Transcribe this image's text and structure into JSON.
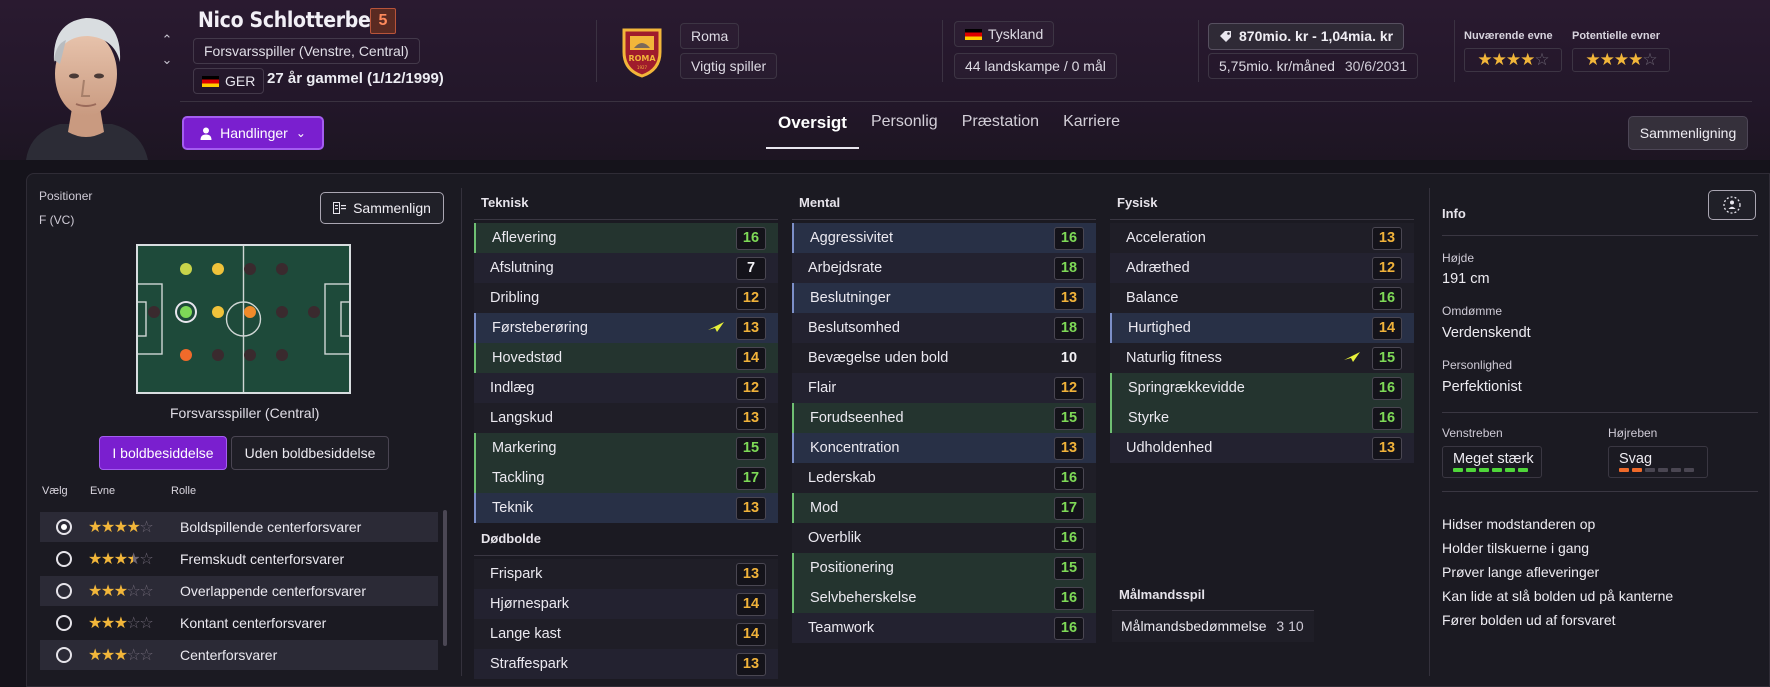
{
  "player": {
    "name": "Nico Schlotterbeck",
    "number": "5",
    "position": "Forsvarsspiller (Venstre, Central)",
    "nationality_code": "GER",
    "age_text": "27 år gammel (1/12/1999)"
  },
  "club": {
    "name": "Roma",
    "role": "Vigtig spiller"
  },
  "country": {
    "name": "Tyskland",
    "caps": "44 landskampe / 0 mål"
  },
  "contract": {
    "value": "870mio. kr - 1,04mia. kr",
    "wage": "5,75mio. kr/måned",
    "expiry": "30/6/2031"
  },
  "ability": {
    "current_label": "Nuværende evne",
    "current_stars": 4,
    "potential_label": "Potentielle evner",
    "potential_stars": 4
  },
  "actions_label": "Handlinger",
  "tabs": [
    {
      "label": "Oversigt",
      "active": true
    },
    {
      "label": "Personlig",
      "active": false
    },
    {
      "label": "Præstation",
      "active": false
    },
    {
      "label": "Karriere",
      "active": false
    }
  ],
  "compare_top_label": "Sammenligning",
  "positions_panel": {
    "title": "Positioner",
    "position_code": "F (VC)",
    "compare_label": "Sammenlign",
    "caption": "Forsvarsspiller (Central)",
    "toggle_on": "I boldbesiddelse",
    "toggle_off": "Uden boldbesiddelse",
    "head_select": "Vælg",
    "head_ability": "Evne",
    "head_role": "Rolle",
    "roles": [
      {
        "name": "Boldspillende centerforsvarer",
        "stars": 4,
        "selected": true
      },
      {
        "name": "Fremskudt centerforsvarer",
        "stars": 3.5,
        "selected": false
      },
      {
        "name": "Overlappende centerforsvarer",
        "stars": 3,
        "selected": false
      },
      {
        "name": "Kontant centerforsvarer",
        "stars": 3,
        "selected": false
      },
      {
        "name": "Centerforsvarer",
        "stars": 3,
        "selected": false
      }
    ]
  },
  "technical": {
    "title": "Teknisk",
    "attrs": [
      {
        "name": "Aflevering",
        "value": "16",
        "hl": "green"
      },
      {
        "name": "Afslutning",
        "value": "7",
        "hl": ""
      },
      {
        "name": "Dribling",
        "value": "12",
        "hl": ""
      },
      {
        "name": "Førsteberøring",
        "value": "13",
        "hl": "blue",
        "trend": true
      },
      {
        "name": "Hovedstød",
        "value": "14",
        "hl": "green"
      },
      {
        "name": "Indlæg",
        "value": "12",
        "hl": ""
      },
      {
        "name": "Langskud",
        "value": "13",
        "hl": ""
      },
      {
        "name": "Markering",
        "value": "15",
        "hl": "green"
      },
      {
        "name": "Tackling",
        "value": "17",
        "hl": "green"
      },
      {
        "name": "Teknik",
        "value": "13",
        "hl": "blue"
      }
    ]
  },
  "set_pieces": {
    "title": "Dødbolde",
    "attrs": [
      {
        "name": "Frispark",
        "value": "13"
      },
      {
        "name": "Hjørnespark",
        "value": "14"
      },
      {
        "name": "Lange kast",
        "value": "14"
      },
      {
        "name": "Straffespark",
        "value": "13"
      }
    ]
  },
  "mental": {
    "title": "Mental",
    "attrs": [
      {
        "name": "Aggressivitet",
        "value": "16",
        "hl": "blue"
      },
      {
        "name": "Arbejdsrate",
        "value": "18",
        "hl": ""
      },
      {
        "name": "Beslutninger",
        "value": "13",
        "hl": "blue"
      },
      {
        "name": "Beslutsomhed",
        "value": "18",
        "hl": ""
      },
      {
        "name": "Bevægelse uden bold",
        "value": "10",
        "hl": ""
      },
      {
        "name": "Flair",
        "value": "12",
        "hl": ""
      },
      {
        "name": "Forudseenhed",
        "value": "15",
        "hl": "green"
      },
      {
        "name": "Koncentration",
        "value": "13",
        "hl": "blue"
      },
      {
        "name": "Lederskab",
        "value": "16",
        "hl": ""
      },
      {
        "name": "Mod",
        "value": "17",
        "hl": "green"
      },
      {
        "name": "Overblik",
        "value": "16",
        "hl": ""
      },
      {
        "name": "Positionering",
        "value": "15",
        "hl": "green"
      },
      {
        "name": "Selvbeherskelse",
        "value": "16",
        "hl": "green"
      },
      {
        "name": "Teamwork",
        "value": "16",
        "hl": ""
      }
    ]
  },
  "physical": {
    "title": "Fysisk",
    "attrs": [
      {
        "name": "Acceleration",
        "value": "13",
        "hl": ""
      },
      {
        "name": "Adræthed",
        "value": "12",
        "hl": ""
      },
      {
        "name": "Balance",
        "value": "16",
        "hl": ""
      },
      {
        "name": "Hurtighed",
        "value": "14",
        "hl": "blue"
      },
      {
        "name": "Naturlig fitness",
        "value": "15",
        "hl": "",
        "trend": true
      },
      {
        "name": "Springrækkevidde",
        "value": "16",
        "hl": "green"
      },
      {
        "name": "Styrke",
        "value": "16",
        "hl": "green"
      },
      {
        "name": "Udholdenhed",
        "value": "13",
        "hl": ""
      }
    ]
  },
  "goalkeeping": {
    "title": "Målmandsspil",
    "label": "Målmandsbedømmelse",
    "value": "3 10"
  },
  "info": {
    "title": "Info",
    "height_label": "Højde",
    "height": "191 cm",
    "reputation_label": "Omdømme",
    "reputation": "Verdenskendt",
    "personality_label": "Personlighed",
    "personality": "Perfektionist",
    "left_foot_label": "Venstreben",
    "left_foot": "Meget stærk",
    "left_foot_level": 6,
    "right_foot_label": "Højreben",
    "right_foot": "Svag",
    "right_foot_level": 2,
    "traits": [
      "Hidser modstanderen op",
      "Holder tilskuerne i gang",
      "Prøver lange afleveringer",
      "Kan lide at slå bolden ud på kanterne",
      "Fører bolden ud af forsvaret"
    ]
  }
}
